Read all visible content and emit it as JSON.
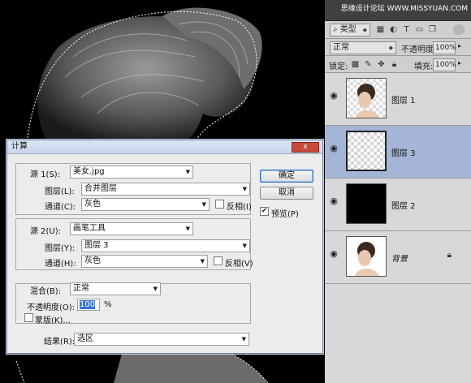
{
  "watermark": "思缘设计论坛 WWW.MISSYUAN.COM",
  "panel": {
    "filter_kind": "类型",
    "blend_mode": "正常",
    "opacity_label": "不透明度:",
    "opacity_value": "100%",
    "lock_label": "锁定:",
    "fill_label": "填充:",
    "fill_value": "100%",
    "layers": [
      {
        "name": "图层 1",
        "active": false,
        "visible": true,
        "locked": false,
        "thumb": "portrait-cutout",
        "italic": false
      },
      {
        "name": "图层 3",
        "active": true,
        "visible": true,
        "locked": false,
        "thumb": "transparent",
        "italic": false
      },
      {
        "name": "图层 2",
        "active": false,
        "visible": true,
        "locked": false,
        "thumb": "black",
        "italic": false
      },
      {
        "name": "背景",
        "active": false,
        "visible": true,
        "locked": true,
        "thumb": "portrait",
        "italic": true
      }
    ]
  },
  "dialog": {
    "title": "计算",
    "close_label": "x",
    "source1": {
      "label": "源 1(S):",
      "value": "美女.jpg",
      "layer_label": "图层(L):",
      "layer_value": "合并图层",
      "channel_label": "通道(C):",
      "channel_value": "灰色",
      "invert_label": "反相(I)"
    },
    "source2": {
      "label": "源 2(U):",
      "value": "画笔工具",
      "layer_label": "图层(Y):",
      "layer_value": "图层 3",
      "channel_label": "通道(H):",
      "channel_value": "灰色",
      "invert_label": "反相(V)"
    },
    "blend": {
      "label": "混合(B):",
      "value": "正常",
      "opacity_label": "不透明度(O):",
      "opacity_value": "100",
      "opacity_unit": "%",
      "mask_label": "蒙版(K)..."
    },
    "result": {
      "label": "结果(R):",
      "value": "选区"
    },
    "ok_label": "确定",
    "cancel_label": "取消",
    "preview_label": "预览(P)",
    "preview_checked": true
  },
  "colors": {
    "active_layer": "#a5b5d8",
    "panel_bg": "#535353",
    "dialog_bg": "#ececec"
  }
}
